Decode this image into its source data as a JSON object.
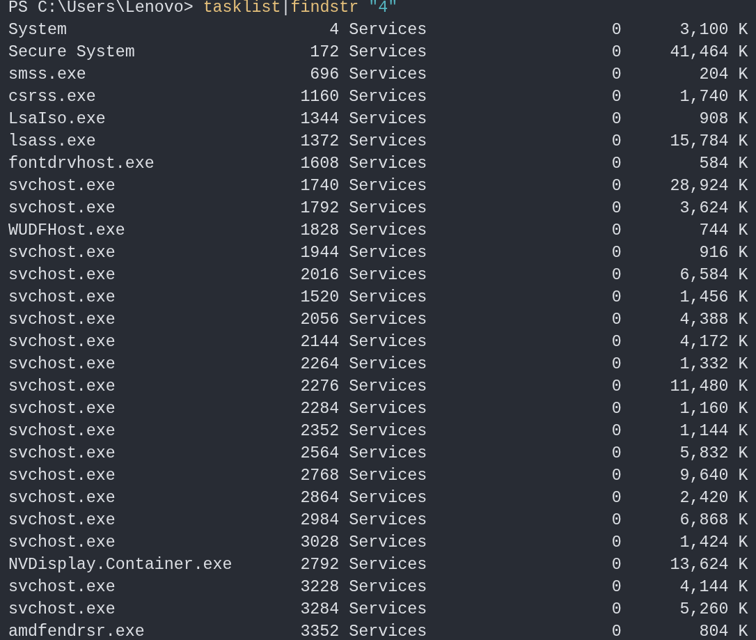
{
  "prompt": {
    "path": "PS C:\\Users\\Lenovo>",
    "command": "tasklist",
    "pipe": "|",
    "filter": "findstr",
    "argument": "\"4\""
  },
  "rows": [
    {
      "name": "System",
      "pid": "4",
      "session": "Services",
      "session_no": "0",
      "mem": "3,100 K"
    },
    {
      "name": "Secure System",
      "pid": "172",
      "session": "Services",
      "session_no": "0",
      "mem": "41,464 K"
    },
    {
      "name": "smss.exe",
      "pid": "696",
      "session": "Services",
      "session_no": "0",
      "mem": "204 K"
    },
    {
      "name": "csrss.exe",
      "pid": "1160",
      "session": "Services",
      "session_no": "0",
      "mem": "1,740 K"
    },
    {
      "name": "LsaIso.exe",
      "pid": "1344",
      "session": "Services",
      "session_no": "0",
      "mem": "908 K"
    },
    {
      "name": "lsass.exe",
      "pid": "1372",
      "session": "Services",
      "session_no": "0",
      "mem": "15,784 K"
    },
    {
      "name": "fontdrvhost.exe",
      "pid": "1608",
      "session": "Services",
      "session_no": "0",
      "mem": "584 K"
    },
    {
      "name": "svchost.exe",
      "pid": "1740",
      "session": "Services",
      "session_no": "0",
      "mem": "28,924 K"
    },
    {
      "name": "svchost.exe",
      "pid": "1792",
      "session": "Services",
      "session_no": "0",
      "mem": "3,624 K"
    },
    {
      "name": "WUDFHost.exe",
      "pid": "1828",
      "session": "Services",
      "session_no": "0",
      "mem": "744 K"
    },
    {
      "name": "svchost.exe",
      "pid": "1944",
      "session": "Services",
      "session_no": "0",
      "mem": "916 K"
    },
    {
      "name": "svchost.exe",
      "pid": "2016",
      "session": "Services",
      "session_no": "0",
      "mem": "6,584 K"
    },
    {
      "name": "svchost.exe",
      "pid": "1520",
      "session": "Services",
      "session_no": "0",
      "mem": "1,456 K"
    },
    {
      "name": "svchost.exe",
      "pid": "2056",
      "session": "Services",
      "session_no": "0",
      "mem": "4,388 K"
    },
    {
      "name": "svchost.exe",
      "pid": "2144",
      "session": "Services",
      "session_no": "0",
      "mem": "4,172 K"
    },
    {
      "name": "svchost.exe",
      "pid": "2264",
      "session": "Services",
      "session_no": "0",
      "mem": "1,332 K"
    },
    {
      "name": "svchost.exe",
      "pid": "2276",
      "session": "Services",
      "session_no": "0",
      "mem": "11,480 K"
    },
    {
      "name": "svchost.exe",
      "pid": "2284",
      "session": "Services",
      "session_no": "0",
      "mem": "1,160 K"
    },
    {
      "name": "svchost.exe",
      "pid": "2352",
      "session": "Services",
      "session_no": "0",
      "mem": "1,144 K"
    },
    {
      "name": "svchost.exe",
      "pid": "2564",
      "session": "Services",
      "session_no": "0",
      "mem": "5,832 K"
    },
    {
      "name": "svchost.exe",
      "pid": "2768",
      "session": "Services",
      "session_no": "0",
      "mem": "9,640 K"
    },
    {
      "name": "svchost.exe",
      "pid": "2864",
      "session": "Services",
      "session_no": "0",
      "mem": "2,420 K"
    },
    {
      "name": "svchost.exe",
      "pid": "2984",
      "session": "Services",
      "session_no": "0",
      "mem": "6,868 K"
    },
    {
      "name": "svchost.exe",
      "pid": "3028",
      "session": "Services",
      "session_no": "0",
      "mem": "1,424 K"
    },
    {
      "name": "NVDisplay.Container.exe",
      "pid": "2792",
      "session": "Services",
      "session_no": "0",
      "mem": "13,624 K"
    },
    {
      "name": "svchost.exe",
      "pid": "3228",
      "session": "Services",
      "session_no": "0",
      "mem": "4,144 K"
    },
    {
      "name": "svchost.exe",
      "pid": "3284",
      "session": "Services",
      "session_no": "0",
      "mem": "5,260 K"
    },
    {
      "name": "amdfendrsr.exe",
      "pid": "3352",
      "session": "Services",
      "session_no": "0",
      "mem": "804 K"
    }
  ]
}
